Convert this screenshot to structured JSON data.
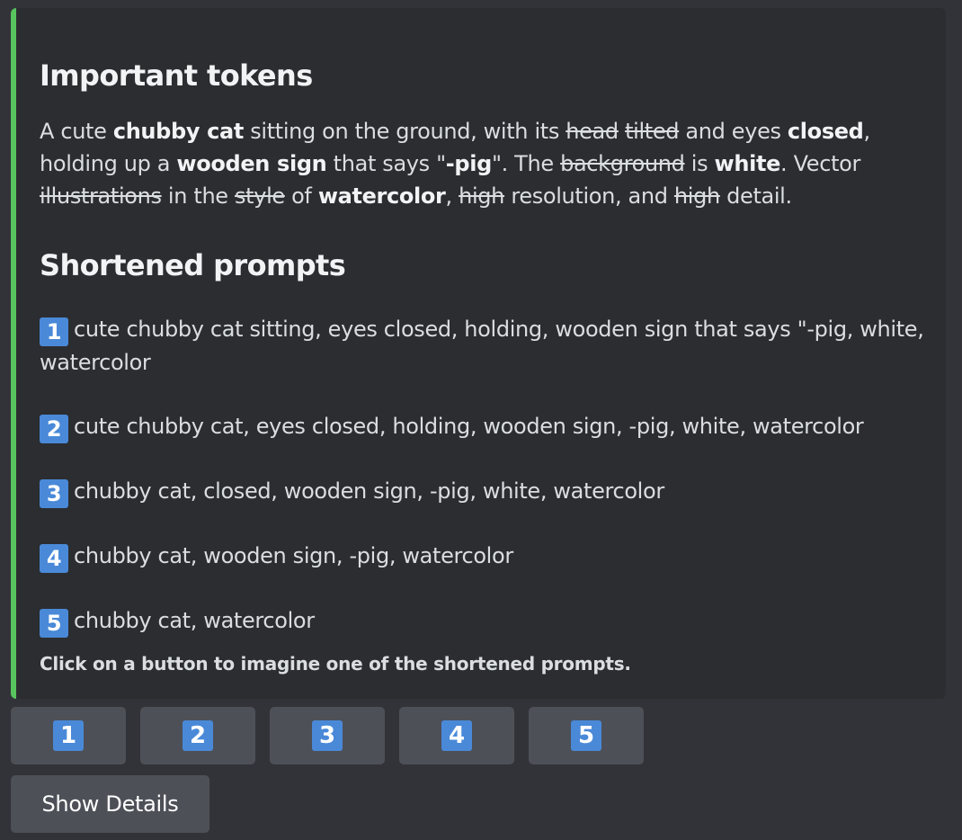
{
  "embed": {
    "accent_color": "#57c45d",
    "important_title": "Important tokens",
    "tokens": [
      {
        "t": "A cute ",
        "s": "n"
      },
      {
        "t": "chubby cat",
        "s": "b"
      },
      {
        "t": " sitting on the ground, with its ",
        "s": "n"
      },
      {
        "t": "head",
        "s": "x"
      },
      {
        "t": " ",
        "s": "n"
      },
      {
        "t": "tilted",
        "s": "x"
      },
      {
        "t": " and eyes ",
        "s": "n"
      },
      {
        "t": "closed",
        "s": "b"
      },
      {
        "t": ", holding up a ",
        "s": "n"
      },
      {
        "t": "wooden sign",
        "s": "b"
      },
      {
        "t": " that says \"",
        "s": "n"
      },
      {
        "t": "-pig",
        "s": "b"
      },
      {
        "t": "\". The ",
        "s": "n"
      },
      {
        "t": "background",
        "s": "x"
      },
      {
        "t": " is ",
        "s": "n"
      },
      {
        "t": "white",
        "s": "b"
      },
      {
        "t": ". Vector ",
        "s": "n"
      },
      {
        "t": "illustrations",
        "s": "x"
      },
      {
        "t": " in the ",
        "s": "n"
      },
      {
        "t": "style",
        "s": "x"
      },
      {
        "t": " of ",
        "s": "n"
      },
      {
        "t": "watercolor",
        "s": "b"
      },
      {
        "t": ", ",
        "s": "n"
      },
      {
        "t": "high",
        "s": "x"
      },
      {
        "t": " resolution, and ",
        "s": "n"
      },
      {
        "t": "high",
        "s": "x"
      },
      {
        "t": " detail.",
        "s": "n"
      }
    ],
    "shortened_title": "Shortened prompts",
    "prompts": [
      {
        "num": "1",
        "text": "cute chubby cat sitting, eyes closed, holding, wooden sign that says \"-pig, white, watercolor"
      },
      {
        "num": "2",
        "text": "cute chubby cat, eyes closed, holding, wooden sign, -pig, white, watercolor"
      },
      {
        "num": "3",
        "text": "chubby cat, closed, wooden sign, -pig, white, watercolor"
      },
      {
        "num": "4",
        "text": "chubby cat, wooden sign, -pig, watercolor"
      },
      {
        "num": "5",
        "text": "chubby cat, watercolor"
      }
    ],
    "hint": "Click on a button to imagine one of the shortened prompts."
  },
  "buttons": [
    "1",
    "2",
    "3",
    "4",
    "5"
  ],
  "details_label": "Show Details",
  "colors": {
    "background": "#323339",
    "embed_background": "#2b2d31",
    "badge": "#4a89d8",
    "button": "#4e5058"
  }
}
